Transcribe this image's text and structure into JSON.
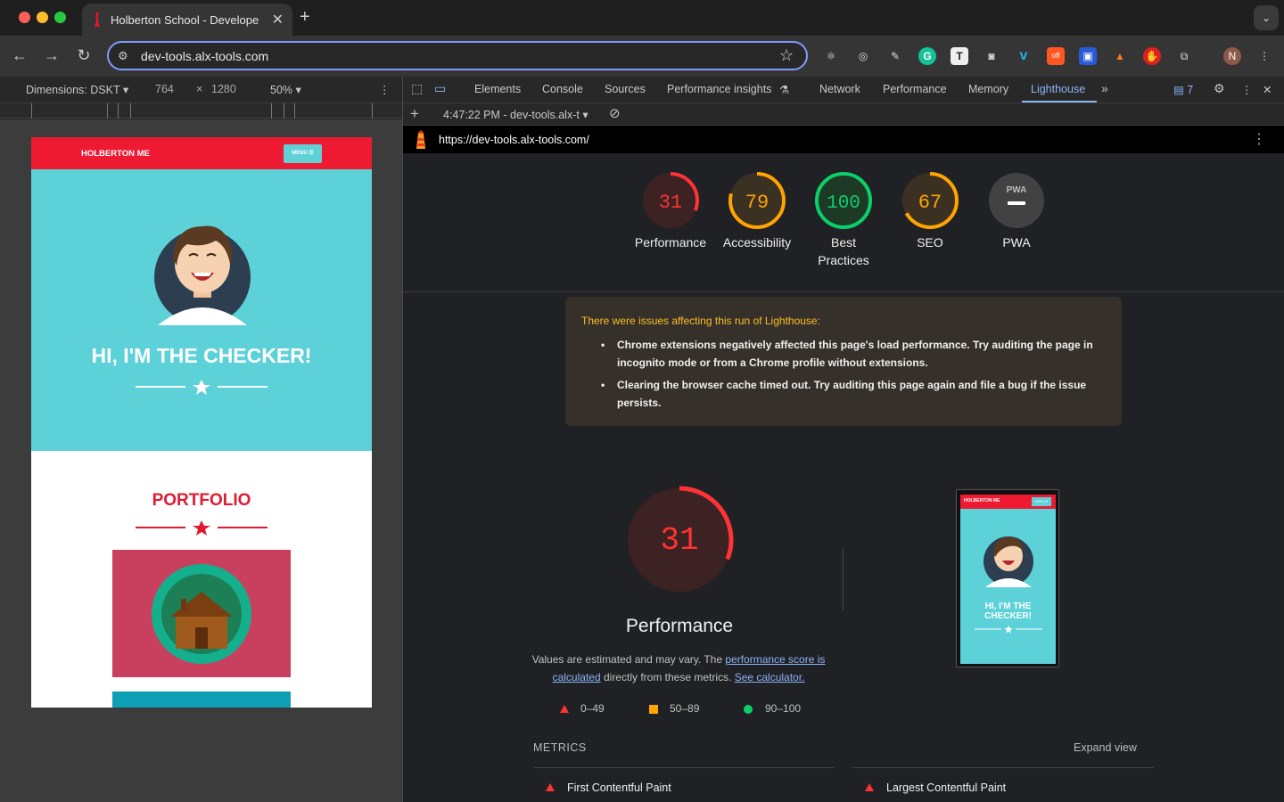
{
  "browser": {
    "tab_title": "Holberton School - Develope",
    "address": "dev-tools.alx-tools.com",
    "profile_initial": "N",
    "ext_badge": "off"
  },
  "device_toolbar": {
    "dimensions_label": "Dimensions: DSKT",
    "width": "764",
    "times": "×",
    "height": "1280",
    "zoom": "50%"
  },
  "devtools": {
    "tabs": [
      "Elements",
      "Console",
      "Sources",
      "Performance insights",
      "Network",
      "Performance",
      "Memory",
      "Lighthouse"
    ],
    "active_tab": "Lighthouse",
    "issues_count": "7",
    "report_time": "4:47:22 PM - dev-tools.alx-t"
  },
  "lighthouse": {
    "report_url": "https://dev-tools.alx-tools.com/",
    "scores": [
      {
        "label": "Performance",
        "label2": "",
        "score": 31,
        "color": "#ff3333",
        "bg": "#3c2222"
      },
      {
        "label": "Accessibility",
        "label2": "",
        "score": 79,
        "color": "#ffa400",
        "bg": "#3a3122"
      },
      {
        "label": "Best",
        "label2": "Practices",
        "score": 100,
        "color": "#0cce6b",
        "bg": "#1d3a27"
      },
      {
        "label": "SEO",
        "label2": "",
        "score": 67,
        "color": "#ffa400",
        "bg": "#3a3122"
      },
      {
        "label": "PWA",
        "label2": "",
        "score": null,
        "color": "#9e9e9e",
        "bg": "#424242"
      }
    ],
    "pwa_badge": "PWA",
    "warning_head": "There were issues affecting this run of Lighthouse:",
    "warnings": [
      "Chrome extensions negatively affected this page's load performance. Try auditing the page in incognito mode or from a Chrome profile without extensions.",
      "Clearing the browser cache timed out. Try auditing this page again and file a bug if the issue persists."
    ],
    "perf_score": 31,
    "perf_title": "Performance",
    "desc_1": "Values are estimated and may vary. The ",
    "desc_link1": "performance score is calculated",
    "desc_2": " directly from these metrics. ",
    "desc_link2": "See calculator.",
    "legend": {
      "fail": "0–49",
      "average": "50–89",
      "pass": "90–100"
    },
    "metrics_label": "METRICS",
    "expand_label": "Expand view",
    "metrics": [
      "First Contentful Paint",
      "Largest Contentful Paint"
    ]
  },
  "site": {
    "brand": "HOLBERTON ME",
    "menu": "MENU ☰",
    "hello": "HI, I'M THE CHECKER!",
    "portfolio": "PORTFOLIO",
    "shot_hello_1": "HI, I'M THE",
    "shot_hello_2": "CHECKER!"
  },
  "colors": {
    "brand_red": "#ed1a32",
    "hero_teal": "#5dd1d8",
    "accent_blue": "#8ab4f8"
  }
}
